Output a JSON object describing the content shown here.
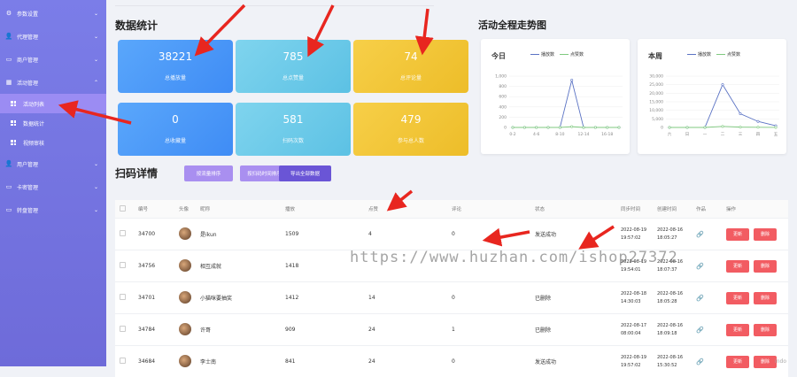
{
  "sidebar": {
    "items": [
      {
        "label": "参数设置",
        "icon": "gear-icon"
      },
      {
        "label": "代理管理",
        "icon": "user-icon"
      },
      {
        "label": "商户管理",
        "icon": "shop-icon"
      },
      {
        "label": "活动管理",
        "icon": "calendar-icon"
      },
      {
        "label": "用户管理",
        "icon": "user-icon"
      },
      {
        "label": "卡密管理",
        "icon": "card-icon"
      },
      {
        "label": "转盘管理",
        "icon": "wheel-icon"
      }
    ],
    "sub": [
      {
        "label": "活动列表"
      },
      {
        "label": "数据统计"
      },
      {
        "label": "视频审核"
      }
    ]
  },
  "stats": {
    "title": "数据统计",
    "cards": [
      {
        "value": "38221",
        "label": "总播放量"
      },
      {
        "value": "785",
        "label": "总点赞量"
      },
      {
        "value": "74",
        "label": "总评论量"
      },
      {
        "value": "0",
        "label": "总收藏量"
      },
      {
        "value": "581",
        "label": "扫码次数"
      },
      {
        "value": "479",
        "label": "参与总人数"
      }
    ]
  },
  "trend": {
    "title": "活动全程走势图",
    "legend": [
      "播放数",
      "点赞数"
    ],
    "colors": {
      "play": "#5b73c4",
      "like": "#7fc97f"
    }
  },
  "chart_data": [
    {
      "type": "line",
      "title": "今日",
      "x": [
        "0-2",
        "2-4",
        "4-6",
        "6-8",
        "8-10",
        "10-12",
        "12-14",
        "14-16",
        "16-18",
        "18-20"
      ],
      "xticks": [
        "0-2",
        "4-6",
        "8-10",
        "12-14",
        "16-18"
      ],
      "ylim": [
        0,
        1000
      ],
      "yticks": [
        "1,000",
        "800",
        "600",
        "400",
        "200",
        "0"
      ],
      "series": [
        {
          "name": "播放数",
          "values": [
            0,
            0,
            0,
            0,
            0,
            920,
            0,
            0,
            0,
            0
          ]
        },
        {
          "name": "点赞数",
          "values": [
            0,
            0,
            0,
            0,
            0,
            15,
            0,
            0,
            0,
            0
          ]
        }
      ]
    },
    {
      "type": "line",
      "title": "本周",
      "x": [
        "六",
        "日",
        "一",
        "二",
        "三",
        "四",
        "五"
      ],
      "ylim": [
        0,
        30000
      ],
      "yticks": [
        "30,000",
        "25,000",
        "20,000",
        "15,000",
        "10,000",
        "5,000",
        "0"
      ],
      "series": [
        {
          "name": "播放数",
          "values": [
            0,
            0,
            0,
            25000,
            8000,
            3500,
            1000
          ]
        },
        {
          "name": "点赞数",
          "values": [
            0,
            0,
            0,
            600,
            200,
            100,
            30
          ]
        }
      ]
    }
  ],
  "scan": {
    "title": "扫码详情",
    "buttons": [
      "按流量排序",
      "按扫码时间排序",
      "导出全部数据"
    ],
    "button_colors": [
      "#a98ff0",
      "#a98ff0",
      "#6a55d6"
    ],
    "columns": [
      "编号",
      "头像",
      "昵称",
      "播放",
      "点赞",
      "评论",
      "状态",
      "同步时间",
      "创建时间",
      "作品",
      "操作"
    ],
    "action_labels": [
      "更新",
      "删除"
    ],
    "rows": [
      {
        "id": "34700",
        "nick": "是ikun",
        "play": "1509",
        "like": "4",
        "comment": "0",
        "status": "发送成功",
        "sync": "2022-08-19\n19:57:02",
        "create": "2022-08-16\n18:05:27"
      },
      {
        "id": "34756",
        "nick": "相互成就",
        "play": "1418",
        "like": "",
        "comment": "",
        "status": "",
        "sync": "2022-08-19\n19:54:01",
        "create": "2022-08-16\n18:07:37"
      },
      {
        "id": "34701",
        "nick": "小猫咪要抽奖",
        "play": "1412",
        "like": "14",
        "comment": "0",
        "status": "已删除",
        "sync": "2022-08-18\n14:30:03",
        "create": "2022-08-16\n18:05:28"
      },
      {
        "id": "34784",
        "nick": "许哥",
        "play": "909",
        "like": "24",
        "comment": "1",
        "status": "已删除",
        "sync": "2022-08-17\n08:00:04",
        "create": "2022-08-16\n18:09:18"
      },
      {
        "id": "34684",
        "nick": "李士南",
        "play": "841",
        "like": "24",
        "comment": "0",
        "status": "发送成功",
        "sync": "2022-08-19\n19:57:02",
        "create": "2022-08-16\n15:30:52"
      }
    ]
  },
  "watermark": "https://www.huzhan.com/ishop27372",
  "corner_text": "indo"
}
